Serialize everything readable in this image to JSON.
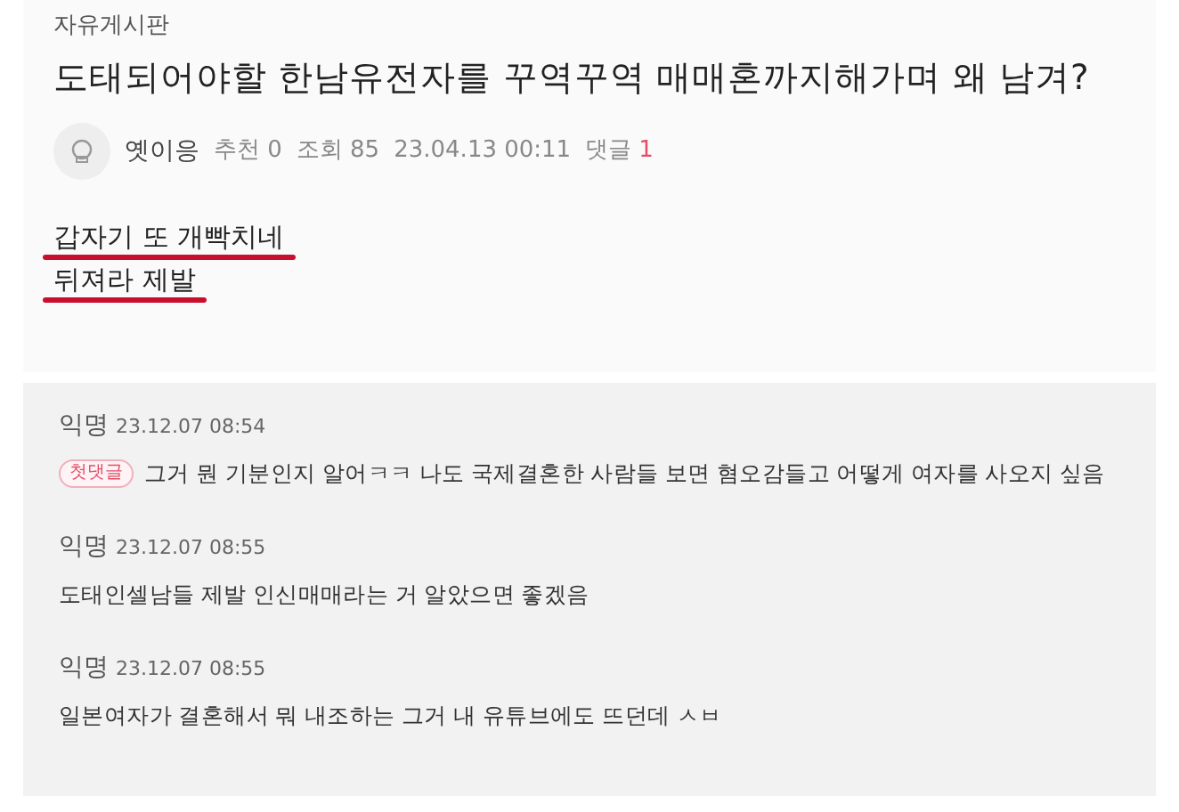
{
  "post": {
    "board": "자유게시판",
    "title": "도태되어야할 한남유전자를 꾸역꾸역 매매혼까지해가며 왜 남겨?",
    "author": "옛이응",
    "recommend": "추천 0",
    "views": "조회 85",
    "date": "23.04.13 00:11",
    "comment_label": "댓글",
    "comment_count": "1",
    "body": [
      {
        "text": "갑자기 또 개빡치네",
        "underlined": true
      },
      {
        "text": "뒤져라 제발",
        "underlined": true
      }
    ]
  },
  "comments": [
    {
      "author": "익명",
      "time": "23.12.07 08:54",
      "badge": "첫댓글",
      "text": "그거 뭔 기분인지 알어ㅋㅋ 나도 국제결혼한 사람들 보면 혐오감들고 어떻게 여자를 사오지 싶음"
    },
    {
      "author": "익명",
      "time": "23.12.07 08:55",
      "text": "도태인셀남들 제발 인신매매라는 거 알았으면 좋겠음"
    },
    {
      "author": "익명",
      "time": "23.12.07 08:55",
      "text": "일본여자가 결혼해서 뭐 내조하는 그거 내 유튜브에도 뜨던데 ㅅㅂ"
    }
  ]
}
